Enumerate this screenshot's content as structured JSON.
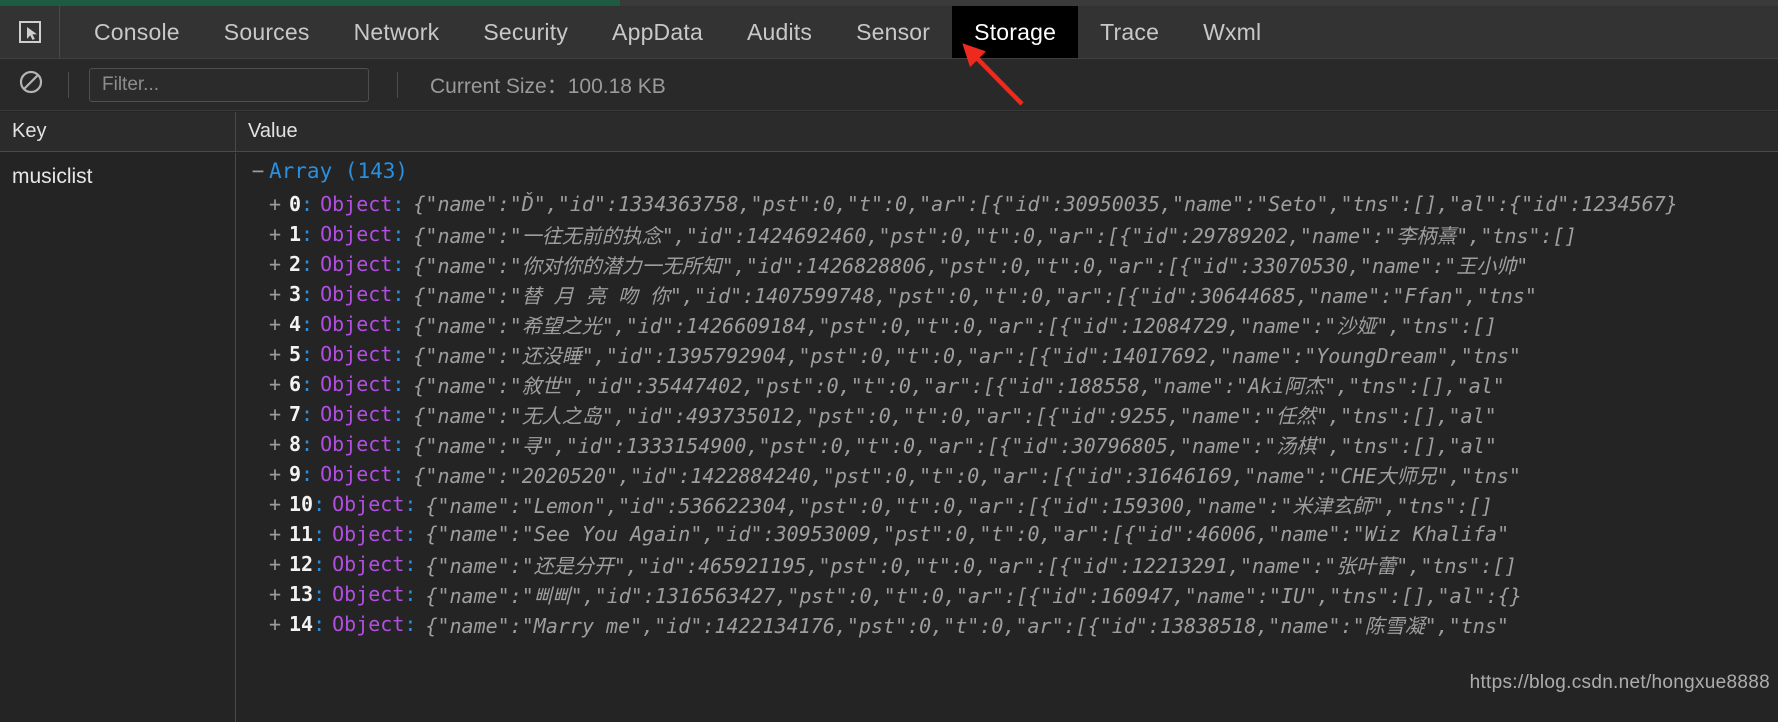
{
  "devtools": {
    "inspect_icon": "cursor-select-icon",
    "tabs": [
      {
        "label": "Console",
        "active": false
      },
      {
        "label": "Sources",
        "active": false
      },
      {
        "label": "Network",
        "active": false
      },
      {
        "label": "Security",
        "active": false
      },
      {
        "label": "AppData",
        "active": false
      },
      {
        "label": "Audits",
        "active": false
      },
      {
        "label": "Sensor",
        "active": false
      },
      {
        "label": "Storage",
        "active": true
      },
      {
        "label": "Trace",
        "active": false
      },
      {
        "label": "Wxml",
        "active": false
      }
    ]
  },
  "toolbar": {
    "clear_icon": "block-clear-icon",
    "filter_placeholder": "Filter...",
    "filter_value": "",
    "current_size_label": "Current Size：100.18 KB"
  },
  "table": {
    "columns": [
      "Key",
      "Value"
    ],
    "key": "musiclist",
    "array_expander": "−",
    "array_label": "Array (143)",
    "rows": [
      {
        "expander": "+",
        "index": "0",
        "type": "Object",
        "preview": "{\"name\":\"Ď\",\"id\":1334363758,\"pst\":0,\"t\":0,\"ar\":[{\"id\":30950035,\"name\":\"Seto\",\"tns\":[],\"al\":{\"id\":1234567}"
      },
      {
        "expander": "+",
        "index": "1",
        "type": "Object",
        "preview": "{\"name\":\"一往无前的执念\",\"id\":1424692460,\"pst\":0,\"t\":0,\"ar\":[{\"id\":29789202,\"name\":\"李柄熹\",\"tns\":[]"
      },
      {
        "expander": "+",
        "index": "2",
        "type": "Object",
        "preview": "{\"name\":\"你对你的潜力一无所知\",\"id\":1426828806,\"pst\":0,\"t\":0,\"ar\":[{\"id\":33070530,\"name\":\"王小帅\""
      },
      {
        "expander": "+",
        "index": "3",
        "type": "Object",
        "preview": "{\"name\":\"替 月 亮 吻 你\",\"id\":1407599748,\"pst\":0,\"t\":0,\"ar\":[{\"id\":30644685,\"name\":\"Ffan\",\"tns\""
      },
      {
        "expander": "+",
        "index": "4",
        "type": "Object",
        "preview": "{\"name\":\"希望之光\",\"id\":1426609184,\"pst\":0,\"t\":0,\"ar\":[{\"id\":12084729,\"name\":\"沙娅\",\"tns\":[]"
      },
      {
        "expander": "+",
        "index": "5",
        "type": "Object",
        "preview": "{\"name\":\"还没睡\",\"id\":1395792904,\"pst\":0,\"t\":0,\"ar\":[{\"id\":14017692,\"name\":\"YoungDream\",\"tns\""
      },
      {
        "expander": "+",
        "index": "6",
        "type": "Object",
        "preview": "{\"name\":\"敘世\",\"id\":35447402,\"pst\":0,\"t\":0,\"ar\":[{\"id\":188558,\"name\":\"Aki阿杰\",\"tns\":[],\"al\""
      },
      {
        "expander": "+",
        "index": "7",
        "type": "Object",
        "preview": "{\"name\":\"无人之岛\",\"id\":493735012,\"pst\":0,\"t\":0,\"ar\":[{\"id\":9255,\"name\":\"任然\",\"tns\":[],\"al\""
      },
      {
        "expander": "+",
        "index": "8",
        "type": "Object",
        "preview": "{\"name\":\"寻\",\"id\":1333154900,\"pst\":0,\"t\":0,\"ar\":[{\"id\":30796805,\"name\":\"汤棋\",\"tns\":[],\"al\""
      },
      {
        "expander": "+",
        "index": "9",
        "type": "Object",
        "preview": "{\"name\":\"2020520\",\"id\":1422884240,\"pst\":0,\"t\":0,\"ar\":[{\"id\":31646169,\"name\":\"CHE大师兄\",\"tns\""
      },
      {
        "expander": "+",
        "index": "10",
        "type": "Object",
        "preview": "{\"name\":\"Lemon\",\"id\":536622304,\"pst\":0,\"t\":0,\"ar\":[{\"id\":159300,\"name\":\"米津玄師\",\"tns\":[]"
      },
      {
        "expander": "+",
        "index": "11",
        "type": "Object",
        "preview": "{\"name\":\"See You Again\",\"id\":30953009,\"pst\":0,\"t\":0,\"ar\":[{\"id\":46006,\"name\":\"Wiz Khalifa\""
      },
      {
        "expander": "+",
        "index": "12",
        "type": "Object",
        "preview": "{\"name\":\"还是分开\",\"id\":465921195,\"pst\":0,\"t\":0,\"ar\":[{\"id\":12213291,\"name\":\"张叶蕾\",\"tns\":[]"
      },
      {
        "expander": "+",
        "index": "13",
        "type": "Object",
        "preview": "{\"name\":\"삐삐\",\"id\":1316563427,\"pst\":0,\"t\":0,\"ar\":[{\"id\":160947,\"name\":\"IU\",\"tns\":[],\"al\":{}"
      },
      {
        "expander": "+",
        "index": "14",
        "type": "Object",
        "preview": "{\"name\":\"Marry me\",\"id\":1422134176,\"pst\":0,\"t\":0,\"ar\":[{\"id\":13838518,\"name\":\"陈雪凝\",\"tns\""
      }
    ]
  },
  "annotation": {
    "arrow_color": "#ee2a1e"
  },
  "watermark": {
    "text": "https://blog.csdn.net/hongxue8888"
  }
}
